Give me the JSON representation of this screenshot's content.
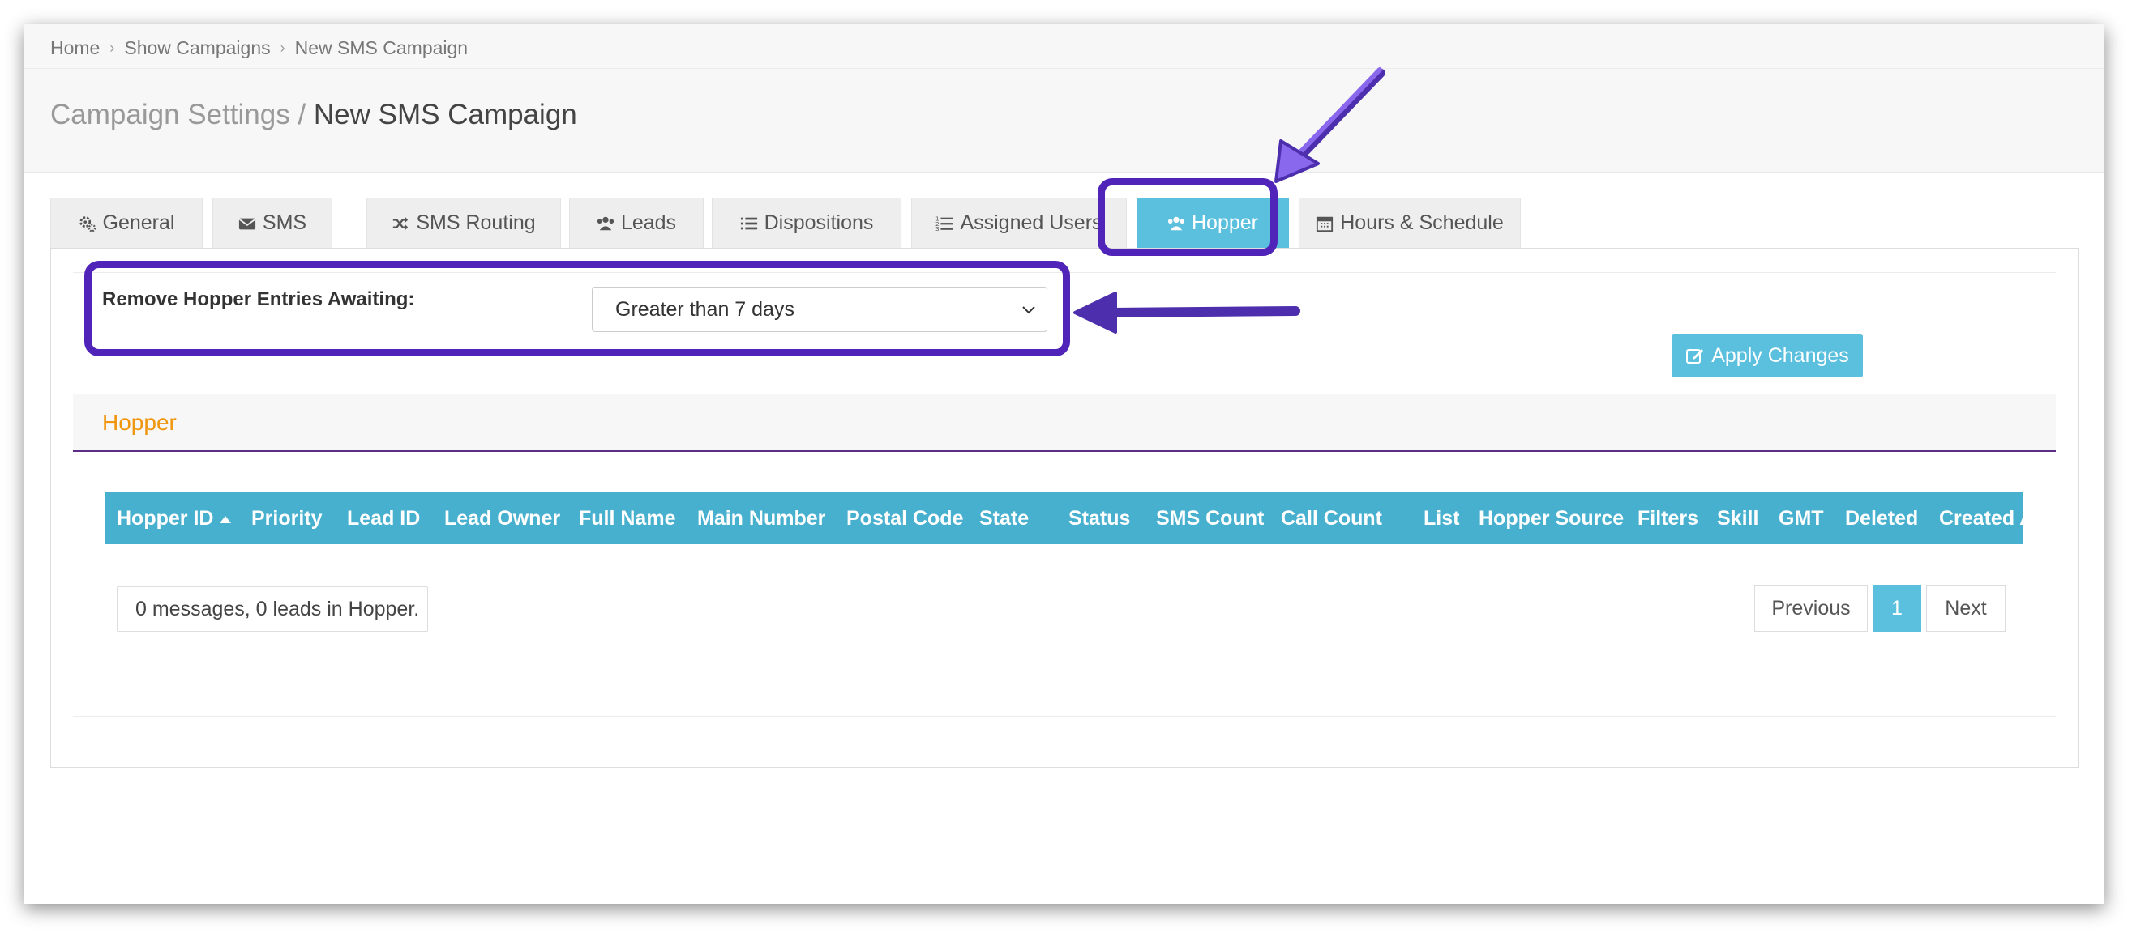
{
  "breadcrumb": {
    "items": [
      {
        "label": "Home"
      },
      {
        "label": "Show Campaigns"
      },
      {
        "label": "New SMS Campaign"
      }
    ]
  },
  "page_title": {
    "prefix": "Campaign Settings /",
    "name": "New SMS Campaign"
  },
  "tabs": [
    {
      "label": "General",
      "icon": "gears-icon",
      "active": false
    },
    {
      "label": "SMS",
      "icon": "envelope-icon",
      "active": false
    },
    {
      "label": "SMS Routing",
      "icon": "random-icon",
      "active": false
    },
    {
      "label": "Leads",
      "icon": "users-icon",
      "active": false
    },
    {
      "label": "Dispositions",
      "icon": "list-icon",
      "active": false
    },
    {
      "label": "Assigned Users",
      "icon": "list-ol-icon",
      "active": false
    },
    {
      "label": "Hopper",
      "icon": "users-icon",
      "active": true
    },
    {
      "label": "Hours & Schedule",
      "icon": "calendar-icon",
      "active": false
    }
  ],
  "hopper_settings": {
    "remove_label": "Remove Hopper Entries Awaiting:",
    "remove_value": "Greater than 7 days",
    "apply_label": "Apply Changes"
  },
  "hopper_section": {
    "title": "Hopper",
    "columns": [
      "Hopper ID",
      "Priority",
      "Lead ID",
      "Lead Owner",
      "Full Name",
      "Main Number",
      "Postal Code",
      "State",
      "Status",
      "SMS Count",
      "Call Count",
      "List",
      "Hopper Source",
      "Filters",
      "Skill",
      "GMT",
      "Deleted",
      "Created At"
    ],
    "sorted_column": "Hopper ID",
    "sort_direction": "ascending",
    "rows": [],
    "info": "0 messages, 0 leads in Hopper.",
    "pagination": {
      "previous": "Previous",
      "current_page": "1",
      "next": "Next"
    }
  },
  "colors": {
    "accent": "#5bc0de",
    "table_header": "#48b0cf",
    "section_title": "#f0950c",
    "section_underline": "#5b2d86",
    "annotation": "#5124b9"
  }
}
